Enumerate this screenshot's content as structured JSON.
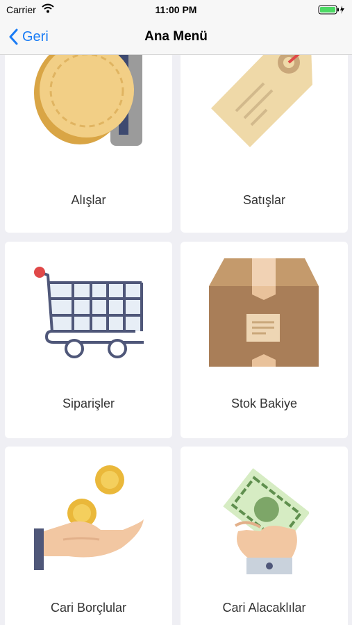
{
  "status_bar": {
    "carrier": "Carrier",
    "time": "11:00 PM"
  },
  "nav": {
    "back_label": "Geri",
    "title": "Ana Menü"
  },
  "menu": {
    "items": [
      {
        "label": "Alışlar"
      },
      {
        "label": "Satışlar"
      },
      {
        "label": "Siparişler"
      },
      {
        "label": "Stok Bakiye"
      },
      {
        "label": "Cari Borçlular"
      },
      {
        "label": "Cari Alacaklılar"
      }
    ]
  },
  "colors": {
    "accent": "#1a7cf5",
    "background": "#efeff4",
    "card": "#ffffff",
    "battery": "#4cd964"
  }
}
